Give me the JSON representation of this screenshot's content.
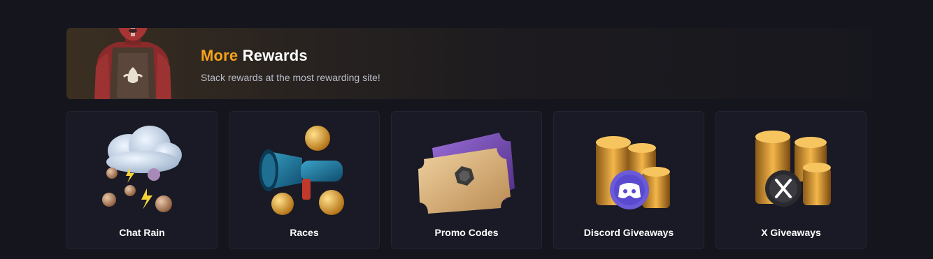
{
  "banner": {
    "title_accent": "More",
    "title_rest": "Rewards",
    "subtitle": "Stack rewards at the most rewarding site!",
    "character_icon": "masked-character-illustration"
  },
  "cards": [
    {
      "label": "Chat Rain",
      "icon": "rain-cloud-coins-icon"
    },
    {
      "label": "Races",
      "icon": "megaphone-coins-icon"
    },
    {
      "label": "Promo Codes",
      "icon": "ticket-icon"
    },
    {
      "label": "Discord Giveaways",
      "icon": "discord-coins-icon"
    },
    {
      "label": "X Giveaways",
      "icon": "x-coins-icon"
    }
  ],
  "colors": {
    "background": "#14151d",
    "accent": "#f7a21b",
    "card_bg": "#191a25",
    "card_border": "#232533"
  }
}
